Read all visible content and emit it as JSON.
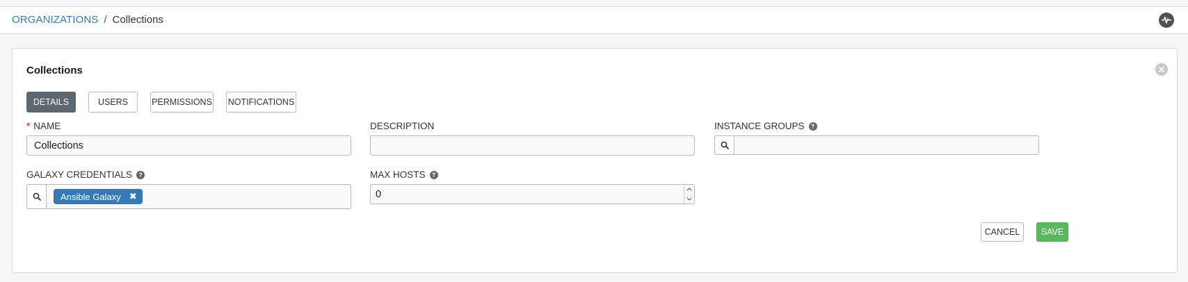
{
  "breadcrumb": {
    "parent": "ORGANIZATIONS",
    "separator": "/",
    "current": "Collections"
  },
  "header": {
    "activity_icon": "activity-stream-icon"
  },
  "panel": {
    "title": "Collections",
    "close_icon": "close-circle-icon"
  },
  "tabs": [
    {
      "label": "DETAILS",
      "active": true
    },
    {
      "label": "USERS",
      "active": false
    },
    {
      "label": "PERMISSIONS",
      "active": false
    },
    {
      "label": "NOTIFICATIONS",
      "active": false
    }
  ],
  "form": {
    "name": {
      "label": "NAME",
      "required_marker": "*",
      "value": "Collections"
    },
    "description": {
      "label": "DESCRIPTION",
      "value": ""
    },
    "instance_groups": {
      "label": "INSTANCE GROUPS",
      "help_icon": "question-circle-icon",
      "value": ""
    },
    "galaxy_credentials": {
      "label": "GALAXY CREDENTIALS",
      "help_icon": "question-circle-icon",
      "chips": [
        {
          "label": "Ansible Galaxy",
          "remove": "✖"
        }
      ]
    },
    "max_hosts": {
      "label": "MAX HOSTS",
      "help_icon": "question-circle-icon",
      "value": "0"
    }
  },
  "actions": {
    "cancel_label": "CANCEL",
    "save_label": "SAVE"
  },
  "colors": {
    "link": "#337ab7",
    "active_tab": "#5e6670",
    "chip": "#337ab7",
    "save": "#5cb85c",
    "required": "#d9534f"
  }
}
